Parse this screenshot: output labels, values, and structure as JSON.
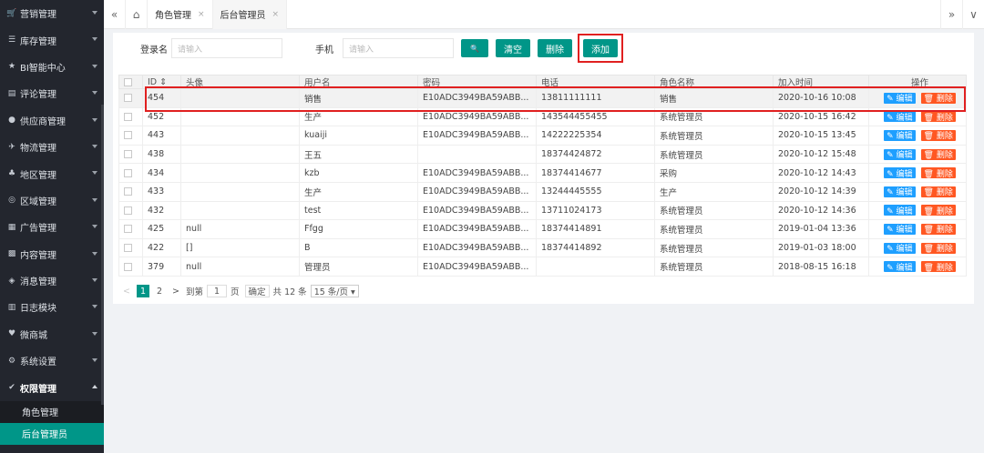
{
  "sidebar": {
    "items": [
      {
        "icon": "🛒",
        "label": "营销管理",
        "name": "sidebar-item-marketing",
        "open": false
      },
      {
        "icon": "☰",
        "label": "库存管理",
        "name": "sidebar-item-inventory",
        "open": false
      },
      {
        "icon": "★",
        "label": "BI智能中心",
        "name": "sidebar-item-bi",
        "open": false
      },
      {
        "icon": "▤",
        "label": "评论管理",
        "name": "sidebar-item-comments",
        "open": false
      },
      {
        "icon": "●",
        "label": "供应商管理",
        "name": "sidebar-item-suppliers",
        "open": false
      },
      {
        "icon": "✈",
        "label": "物流管理",
        "name": "sidebar-item-logistics",
        "open": false
      },
      {
        "icon": "♣",
        "label": "地区管理",
        "name": "sidebar-item-regions",
        "open": false
      },
      {
        "icon": "◎",
        "label": "区域管理",
        "name": "sidebar-item-areas",
        "open": false
      },
      {
        "icon": "▦",
        "label": "广告管理",
        "name": "sidebar-item-ads",
        "open": false
      },
      {
        "icon": "▩",
        "label": "内容管理",
        "name": "sidebar-item-content",
        "open": false
      },
      {
        "icon": "◈",
        "label": "消息管理",
        "name": "sidebar-item-messages",
        "open": false
      },
      {
        "icon": "▥",
        "label": "日志模块",
        "name": "sidebar-item-logs",
        "open": false
      },
      {
        "icon": "♥",
        "label": "微商城",
        "name": "sidebar-item-wemall",
        "open": false
      },
      {
        "icon": "⚙",
        "label": "系统设置",
        "name": "sidebar-item-settings",
        "open": false
      },
      {
        "icon": "✔",
        "label": "权限管理",
        "name": "sidebar-item-permissions",
        "open": true
      }
    ],
    "sub_items": [
      {
        "label": "角色管理",
        "active": false
      },
      {
        "label": "后台管理员",
        "active": true
      }
    ]
  },
  "tabs": {
    "collapse_icon": "«",
    "home_icon": "⌂",
    "items": [
      {
        "label": "角色管理",
        "close": "×"
      },
      {
        "label": "后台管理员",
        "close": "×"
      }
    ],
    "right_icons": [
      "»",
      "∨"
    ]
  },
  "search": {
    "login_label": "登录名",
    "login_placeholder": "请输入",
    "phone_label": "手机",
    "phone_placeholder": "请输入",
    "search_icon": "🔍",
    "clear_label": "清空",
    "delete_label": "删除",
    "add_label": "添加"
  },
  "table": {
    "headers": [
      "ID ⇕",
      "头像",
      "用户名",
      "密码",
      "电话",
      "角色名称",
      "加入时间",
      "操作"
    ],
    "rows": [
      {
        "id": "454",
        "avatar": "",
        "username": "销售",
        "password": "E10ADC3949BA59ABB...",
        "phone": "13811111111",
        "role": "销售",
        "joined": "2020-10-16 10:08"
      },
      {
        "id": "452",
        "avatar": "",
        "username": "生产",
        "password": "E10ADC3949BA59ABB...",
        "phone": "143544455455",
        "role": "系统管理员",
        "joined": "2020-10-15 16:42"
      },
      {
        "id": "443",
        "avatar": "",
        "username": "kuaiji",
        "password": "E10ADC3949BA59ABB...",
        "phone": "14222225354",
        "role": "系统管理员",
        "joined": "2020-10-15 13:45"
      },
      {
        "id": "438",
        "avatar": "",
        "username": "王五",
        "password": "",
        "phone": "18374424872",
        "role": "系统管理员",
        "joined": "2020-10-12 15:48"
      },
      {
        "id": "434",
        "avatar": "",
        "username": "kzb",
        "password": "E10ADC3949BA59ABB...",
        "phone": "18374414677",
        "role": "采购",
        "joined": "2020-10-12 14:43"
      },
      {
        "id": "433",
        "avatar": "",
        "username": "生产",
        "password": "E10ADC3949BA59ABB...",
        "phone": "13244445555",
        "role": "生产",
        "joined": "2020-10-12 14:39"
      },
      {
        "id": "432",
        "avatar": "",
        "username": "test",
        "password": "E10ADC3949BA59ABB...",
        "phone": "13711024173",
        "role": "系统管理员",
        "joined": "2020-10-12 14:36"
      },
      {
        "id": "425",
        "avatar": "null",
        "username": "Ffgg",
        "password": "E10ADC3949BA59ABB...",
        "phone": "18374414891",
        "role": "系统管理员",
        "joined": "2019-01-04 13:36"
      },
      {
        "id": "422",
        "avatar": "[]",
        "username": "B",
        "password": "E10ADC3949BA59ABB...",
        "phone": "18374414892",
        "role": "系统管理员",
        "joined": "2019-01-03 18:00"
      },
      {
        "id": "379",
        "avatar": "null",
        "username": "管理员",
        "password": "E10ADC3949BA59ABB...",
        "phone": "",
        "role": "系统管理员",
        "joined": "2018-08-15 16:18"
      }
    ],
    "edit_label": "✎ 编辑",
    "delete_label": "🗑 删除"
  },
  "pager": {
    "prev": "<",
    "pages": [
      "1",
      "2"
    ],
    "next": ">",
    "goto_label": "到第",
    "goto_value": "1",
    "page_suffix": "页",
    "confirm": "确定",
    "total": "共 12 条",
    "page_size": "15 条/页 ▾"
  }
}
